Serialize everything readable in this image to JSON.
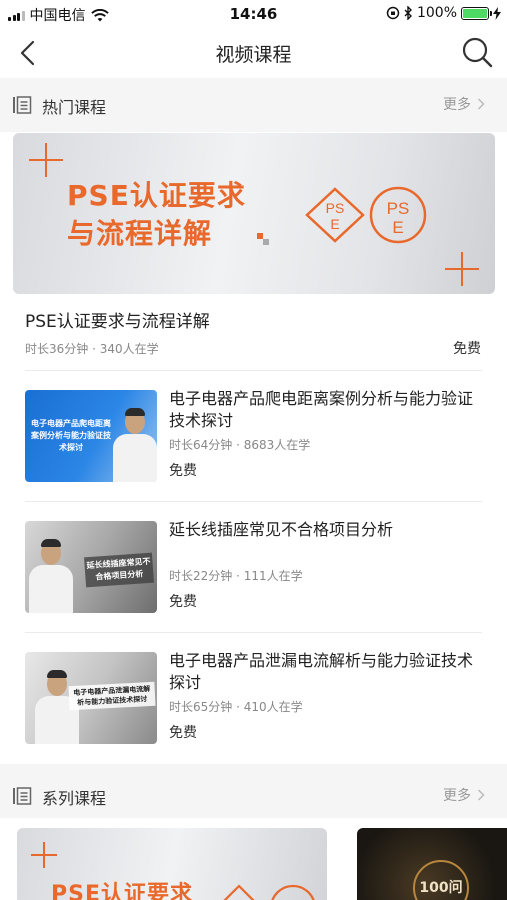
{
  "status_bar": {
    "carrier": "中国电信",
    "time": "14:46",
    "battery": "100%"
  },
  "nav": {
    "title": "视频课程"
  },
  "hot_section": {
    "title": "热门课程",
    "more": "更多",
    "featured": {
      "banner_line1": "PSE认证要求",
      "banner_line2": "与流程详解",
      "logo_diamond": "PSE",
      "logo_circle": "PSE",
      "title": "PSE认证要求与流程详解",
      "meta": "时长36分钟 · 340人在学",
      "price": "免费"
    },
    "courses": [
      {
        "thumb_caption": "电子电器产品爬电距离案例分析与能力验证技术探讨",
        "title": "电子电器产品爬电距离案例分析与能力验证技术探讨",
        "meta": "时长64分钟 · 8683人在学",
        "price": "免费"
      },
      {
        "thumb_caption": "延长线插座常见不合格项目分析",
        "title": "延长线插座常见不合格项目分析",
        "meta": "时长22分钟 · 111人在学",
        "price": "免费"
      },
      {
        "thumb_caption": "电子电器产品泄漏电流解析与能力验证技术探讨",
        "title": "电子电器产品泄漏电流解析与能力验证技术探讨",
        "meta": "时长65分钟 · 410人在学",
        "price": "免费"
      }
    ]
  },
  "series_section": {
    "title": "系列课程",
    "more": "更多",
    "cards": [
      {
        "banner_text": "PSE认证要求"
      },
      {
        "badge": "100问"
      }
    ]
  },
  "colors": {
    "accent": "#e8692b",
    "battery": "#4cd964"
  }
}
